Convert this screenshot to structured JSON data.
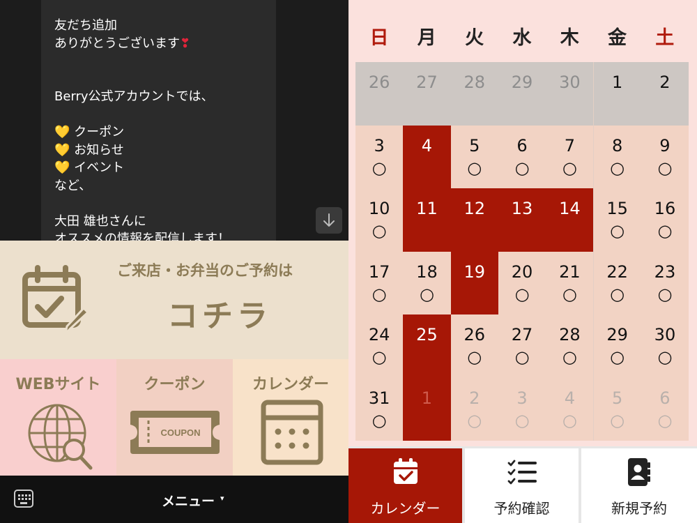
{
  "chat": {
    "lines": [
      {
        "text": "友だち追加",
        "emoji": ""
      },
      {
        "text": "ありがとうございます",
        "emoji": "❣"
      },
      {
        "text": "",
        "emoji": ""
      },
      {
        "text": "",
        "emoji": ""
      },
      {
        "text": "Berry公式アカウントでは、",
        "emoji": ""
      },
      {
        "text": "",
        "emoji": ""
      },
      {
        "text": "クーポン",
        "emoji": "💛"
      },
      {
        "text": "お知らせ",
        "emoji": "💛"
      },
      {
        "text": "イベント",
        "emoji": "💛"
      },
      {
        "text": "など、",
        "emoji": ""
      },
      {
        "text": "",
        "emoji": ""
      },
      {
        "text": "大田 雄也さんに",
        "emoji": ""
      },
      {
        "text": "オススメの情報を配信します！",
        "emoji": ""
      }
    ],
    "scroll_icon": "arrow-down-icon"
  },
  "banner": {
    "subtitle": "ご来店・お弁当のご予約は",
    "title": "コチラ",
    "icon": "calendar-check-edit-icon"
  },
  "tiles": [
    {
      "label": "WEBサイト",
      "icon": "globe-search-icon",
      "color": "#f9cfce"
    },
    {
      "label": "クーポン",
      "icon": "coupon-ticket-icon",
      "text": "COUPON",
      "color": "#f2d0c3"
    },
    {
      "label": "カレンダー",
      "icon": "calendar-grid-icon",
      "color": "#f8e2c9"
    }
  ],
  "menubar": {
    "label": "メニュー",
    "caret": "▾",
    "keyboard_icon": "keyboard-icon"
  },
  "calendar": {
    "weekdays": [
      "日",
      "月",
      "火",
      "水",
      "木",
      "金",
      "土"
    ],
    "open_mark": "○",
    "colors": {
      "closed": "#a61706",
      "open": "#f2d3c4",
      "disabled": "#cdc7c3",
      "holiday_header": "#b01b0d"
    },
    "weeks": [
      [
        {
          "d": "26",
          "s": "prev"
        },
        {
          "d": "27",
          "s": "prev"
        },
        {
          "d": "28",
          "s": "prev"
        },
        {
          "d": "29",
          "s": "prev"
        },
        {
          "d": "30",
          "s": "prev"
        },
        {
          "d": "1",
          "s": "prevcur"
        },
        {
          "d": "2",
          "s": "prevcur"
        }
      ],
      [
        {
          "d": "3",
          "s": "open"
        },
        {
          "d": "4",
          "s": "closed"
        },
        {
          "d": "5",
          "s": "open"
        },
        {
          "d": "6",
          "s": "open"
        },
        {
          "d": "7",
          "s": "open"
        },
        {
          "d": "8",
          "s": "open"
        },
        {
          "d": "9",
          "s": "open"
        }
      ],
      [
        {
          "d": "10",
          "s": "open"
        },
        {
          "d": "11",
          "s": "closed"
        },
        {
          "d": "12",
          "s": "closed"
        },
        {
          "d": "13",
          "s": "closed"
        },
        {
          "d": "14",
          "s": "closed"
        },
        {
          "d": "15",
          "s": "open"
        },
        {
          "d": "16",
          "s": "open"
        }
      ],
      [
        {
          "d": "17",
          "s": "open"
        },
        {
          "d": "18",
          "s": "open"
        },
        {
          "d": "19",
          "s": "closed"
        },
        {
          "d": "20",
          "s": "open"
        },
        {
          "d": "21",
          "s": "open"
        },
        {
          "d": "22",
          "s": "open"
        },
        {
          "d": "23",
          "s": "open"
        }
      ],
      [
        {
          "d": "24",
          "s": "open"
        },
        {
          "d": "25",
          "s": "closed"
        },
        {
          "d": "26",
          "s": "open"
        },
        {
          "d": "27",
          "s": "open"
        },
        {
          "d": "28",
          "s": "open"
        },
        {
          "d": "29",
          "s": "open"
        },
        {
          "d": "30",
          "s": "open"
        }
      ],
      [
        {
          "d": "31",
          "s": "open"
        },
        {
          "d": "1",
          "s": "nextclosed"
        },
        {
          "d": "2",
          "s": "next"
        },
        {
          "d": "3",
          "s": "next"
        },
        {
          "d": "4",
          "s": "next"
        },
        {
          "d": "5",
          "s": "next"
        },
        {
          "d": "6",
          "s": "next"
        }
      ]
    ]
  },
  "tabs": [
    {
      "label": "カレンダー",
      "icon": "calendar-check-icon",
      "active": true
    },
    {
      "label": "予約確認",
      "icon": "checklist-icon",
      "active": false
    },
    {
      "label": "新規予約",
      "icon": "contact-book-icon",
      "active": false
    }
  ]
}
